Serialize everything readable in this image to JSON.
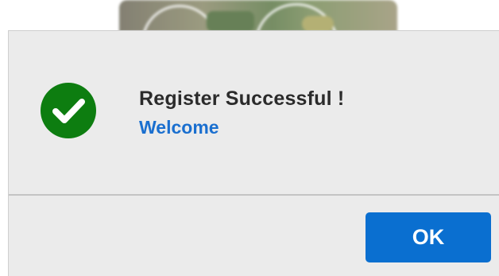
{
  "dialog": {
    "status_icon": "checkmark-circle-icon",
    "title": "Register Successful !",
    "message": "Welcome",
    "ok_label": "OK"
  },
  "colors": {
    "success": "#0d7d10",
    "accent": "#1a6fcf",
    "button": "#0a6fd0",
    "dialog_bg": "#ebebeb"
  }
}
